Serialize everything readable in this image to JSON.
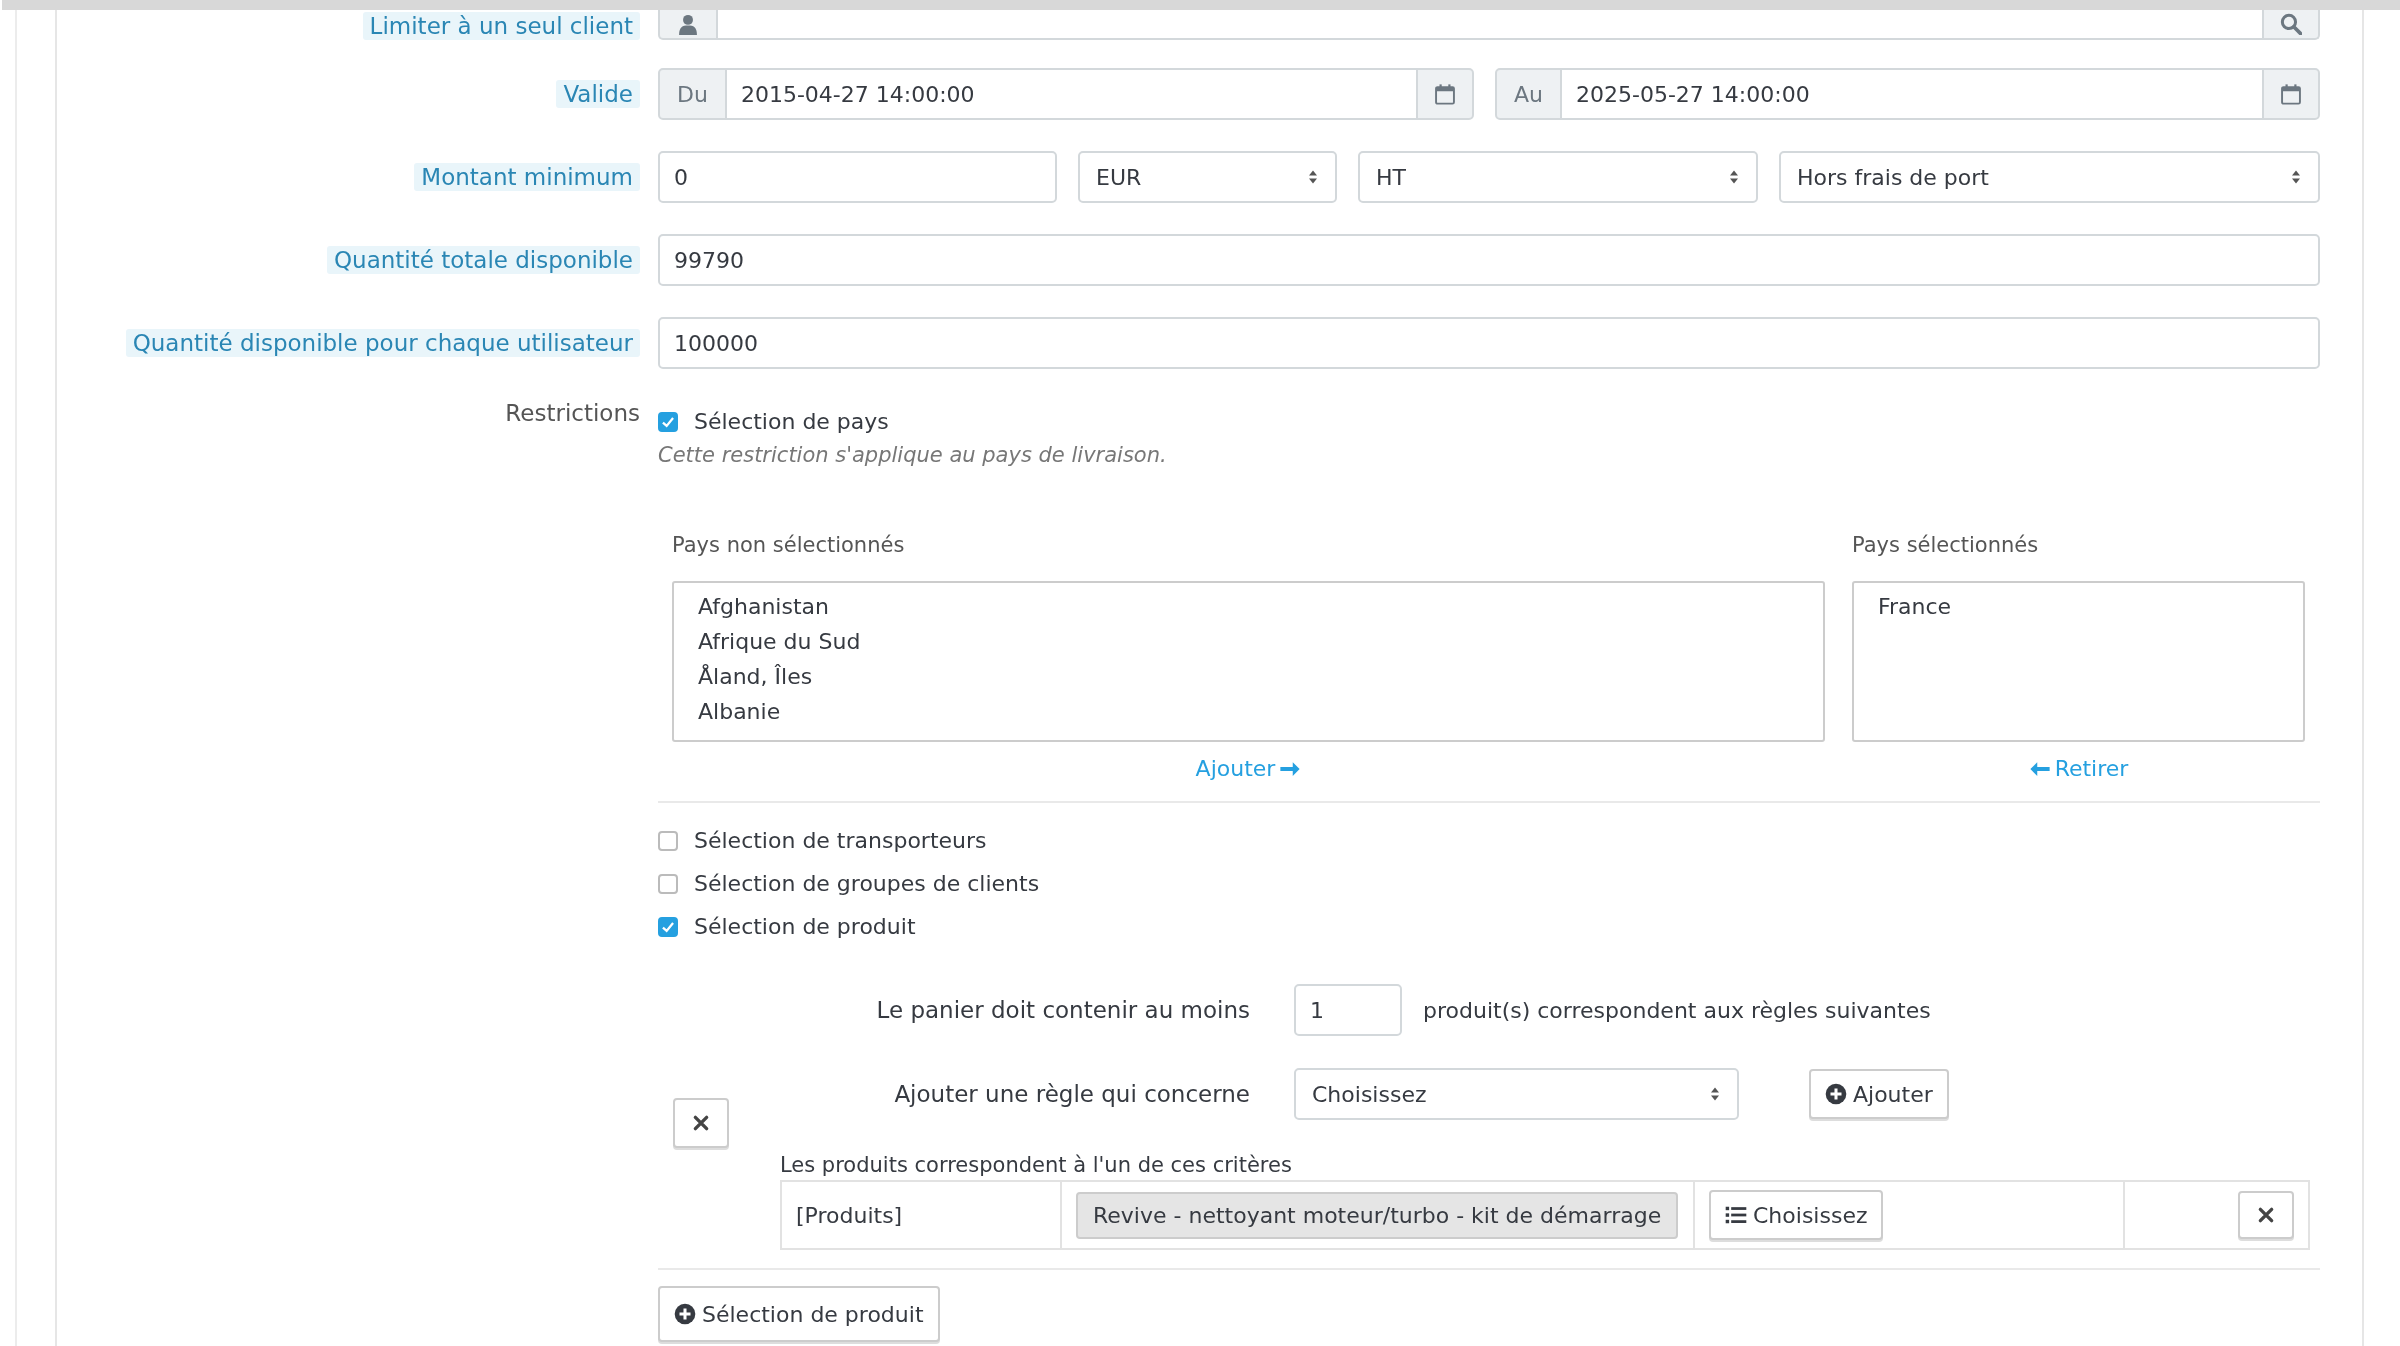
{
  "fields": [
    {
      "kind": "customer",
      "label": "Limiter à un seul client"
    },
    {
      "kind": "dates",
      "label": "Valide",
      "from_prefix": "Du",
      "from": "2015-04-27 14:00:00",
      "to_prefix": "Au",
      "to": "2025-05-27 14:00:00"
    },
    {
      "kind": "amount",
      "label": "Montant minimum",
      "value": "0",
      "currency": "EUR",
      "tax": "HT",
      "shipping": "Hors frais de port"
    },
    {
      "kind": "text",
      "label": "Quantité totale disponible",
      "value": "99790"
    },
    {
      "kind": "text",
      "label": "Quantité disponible pour chaque utilisateur",
      "value": "100000"
    }
  ],
  "restrictions": {
    "label": "Restrictions",
    "country": {
      "label": "Sélection de pays",
      "checked": true,
      "help": "Cette restriction s'applique au pays de livraison.",
      "unselected_title": "Pays non sélectionnés",
      "unselected": [
        "Afghanistan",
        "Afrique du Sud",
        "Åland, Îles",
        "Albanie"
      ],
      "selected_title": "Pays sélectionnés",
      "selected": [
        "France"
      ],
      "add_button": "Ajouter",
      "remove_button": "Retirer"
    },
    "options": [
      {
        "label": "Sélection de transporteurs",
        "checked": false
      },
      {
        "label": "Sélection de groupes de clients",
        "checked": false
      },
      {
        "label": "Sélection de produit",
        "checked": true
      }
    ],
    "product_rules": {
      "quantity_label": "Le panier doit contenir au moins",
      "quantity": "1",
      "quantity_suffix": "produit(s) correspondent aux règles suivantes",
      "rule_label": "Ajouter une règle qui concerne",
      "rule_select": "Choisissez",
      "add_rule_button": "Ajouter",
      "criteria_label": "Les produits correspondent à l'un de ces critères",
      "criteria": [
        {
          "type": "[Produits]",
          "value": "Revive - nettoyant moteur/turbo - kit de démarrage",
          "choose_button": "Choisissez"
        }
      ]
    },
    "add_group_button": "Sélection de produit"
  }
}
